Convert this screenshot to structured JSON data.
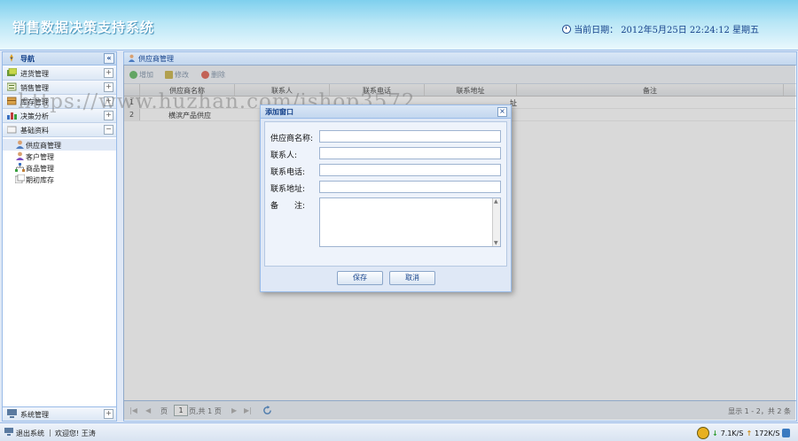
{
  "header": {
    "title": "销售数据决策支持系统",
    "date_label": "当前日期：",
    "date_value": "2012年5月25日  22:24:12 星期五"
  },
  "nav": {
    "title": "导航",
    "collapse": "«",
    "sections": [
      {
        "label": "进货管理",
        "toggle": "+"
      },
      {
        "label": "销售管理",
        "toggle": "+"
      },
      {
        "label": "库存管理",
        "toggle": "+"
      },
      {
        "label": "决策分析",
        "toggle": "+"
      },
      {
        "label": "基础资料",
        "toggle": "−"
      }
    ],
    "items": [
      {
        "label": "供应商管理"
      },
      {
        "label": "客户管理"
      },
      {
        "label": "商品管理"
      },
      {
        "label": "期初库存"
      }
    ],
    "system": {
      "label": "系统管理",
      "toggle": "+"
    }
  },
  "main": {
    "title": "供应商管理",
    "toolbar": {
      "add": "增加",
      "edit": "修改",
      "delete": "删除"
    },
    "columns": [
      "供应商名称",
      "联系人",
      "联系电话",
      "联系地址",
      "备注"
    ],
    "rows": [
      {
        "num": "1",
        "name": "",
        "address": "址"
      },
      {
        "num": "2",
        "name": "横滨产品供应",
        "address": ""
      }
    ],
    "pager": {
      "page_label": "页",
      "page_value": "1",
      "total": "页,共 1 页",
      "summary": "显示 1 - 2，共 2 条"
    }
  },
  "dialog": {
    "title": "添加窗口",
    "close": "×",
    "fields": [
      {
        "label": "供应商名称:",
        "value": ""
      },
      {
        "label": "联系人:",
        "value": ""
      },
      {
        "label": "联系电话:",
        "value": ""
      },
      {
        "label": "联系地址:",
        "value": ""
      }
    ],
    "remark_label": "备　　注:",
    "remark_value": "",
    "save": "保存",
    "cancel": "取消"
  },
  "watermark": "https://www.huzhan.com/ishop3572",
  "status": {
    "logout": "退出系统",
    "welcome": "欢迎您! 王涛",
    "down_speed": "7.1K/S",
    "up_speed": "172K/S"
  },
  "colors": {
    "accent": "#15428b",
    "border": "#99bbe8",
    "header_top": "#7fd0ee"
  }
}
